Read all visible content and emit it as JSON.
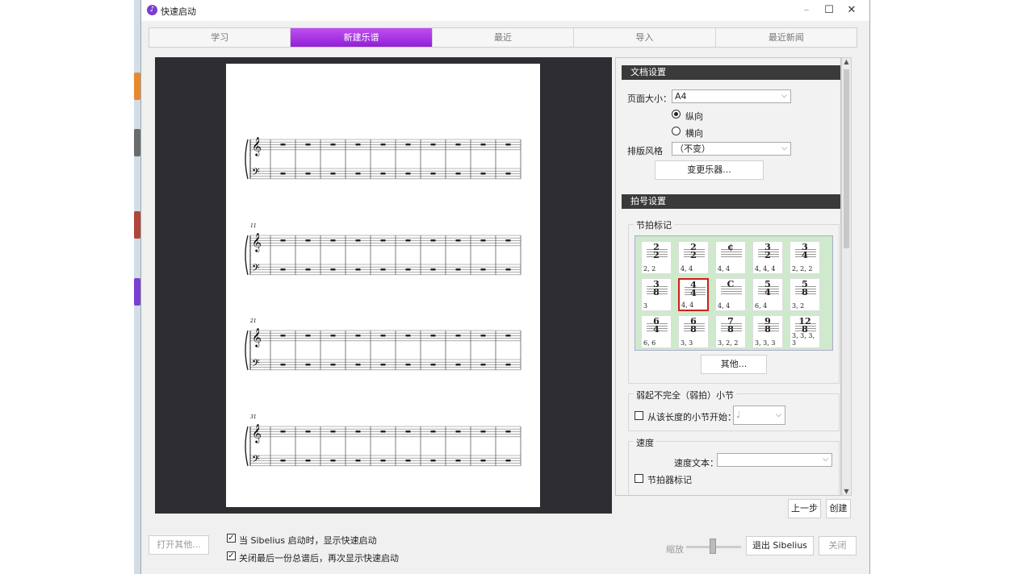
{
  "window": {
    "title": "快速启动"
  },
  "tabs": [
    "学习",
    "新建乐谱",
    "最近",
    "导入",
    "最近新闻"
  ],
  "document_settings": {
    "header": "文档设置",
    "page_size_label": "页面大小：",
    "page_size_value": "A4",
    "orientation_portrait": "纵向",
    "orientation_landscape": "横向",
    "style_label": "排版风格",
    "style_value": "（不变）",
    "change_instruments": "变更乐器..."
  },
  "time_signature": {
    "header": "拍号设置",
    "group_label": "节拍标记",
    "items": [
      {
        "top": "2",
        "bottom": "2",
        "cap": "2, 2"
      },
      {
        "top": "2",
        "bottom": "2",
        "cap": "4, 4"
      },
      {
        "top": "¢",
        "bottom": "",
        "cap": "4, 4"
      },
      {
        "top": "3",
        "bottom": "2",
        "cap": "4, 4, 4"
      },
      {
        "top": "3",
        "bottom": "4",
        "cap": "2, 2, 2"
      },
      {
        "top": "3",
        "bottom": "8",
        "cap": "3"
      },
      {
        "top": "4",
        "bottom": "4",
        "cap": "4, 4"
      },
      {
        "top": "C",
        "bottom": "",
        "cap": "4, 4"
      },
      {
        "top": "5",
        "bottom": "4",
        "cap": "6, 4"
      },
      {
        "top": "5",
        "bottom": "8",
        "cap": "3, 2"
      },
      {
        "top": "6",
        "bottom": "4",
        "cap": "6, 6"
      },
      {
        "top": "6",
        "bottom": "8",
        "cap": "3, 3"
      },
      {
        "top": "7",
        "bottom": "8",
        "cap": "3, 2, 2"
      },
      {
        "top": "9",
        "bottom": "8",
        "cap": "3, 3, 3"
      },
      {
        "top": "12",
        "bottom": "8",
        "cap": "3, 3, 3, 3"
      }
    ],
    "other_button": "其他..."
  },
  "pickup": {
    "group_label": "弱起不完全（弱拍）小节",
    "checkbox_label": "从该长度的小节开始：",
    "note_value": "♩"
  },
  "tempo": {
    "group_label": "速度",
    "text_label": "速度文本：",
    "metronome_label": "节拍器标记"
  },
  "nav": {
    "back": "上一步",
    "create": "创建"
  },
  "bottom": {
    "open_other": "打开其他...",
    "show_on_start": "当 Sibelius 启动时，显示快速启动",
    "show_on_close": "关闭最后一份总谱后，再次显示快速启动",
    "zoom": "缩放",
    "quit": "退出 Sibelius",
    "close": "关闭"
  },
  "score": {
    "measure_numbers": [
      "11",
      "21",
      "31"
    ]
  },
  "colors": {
    "tab_active": "#a43be2",
    "selected_border": "#c8211c",
    "grid_bg": "#cfe9cc"
  }
}
